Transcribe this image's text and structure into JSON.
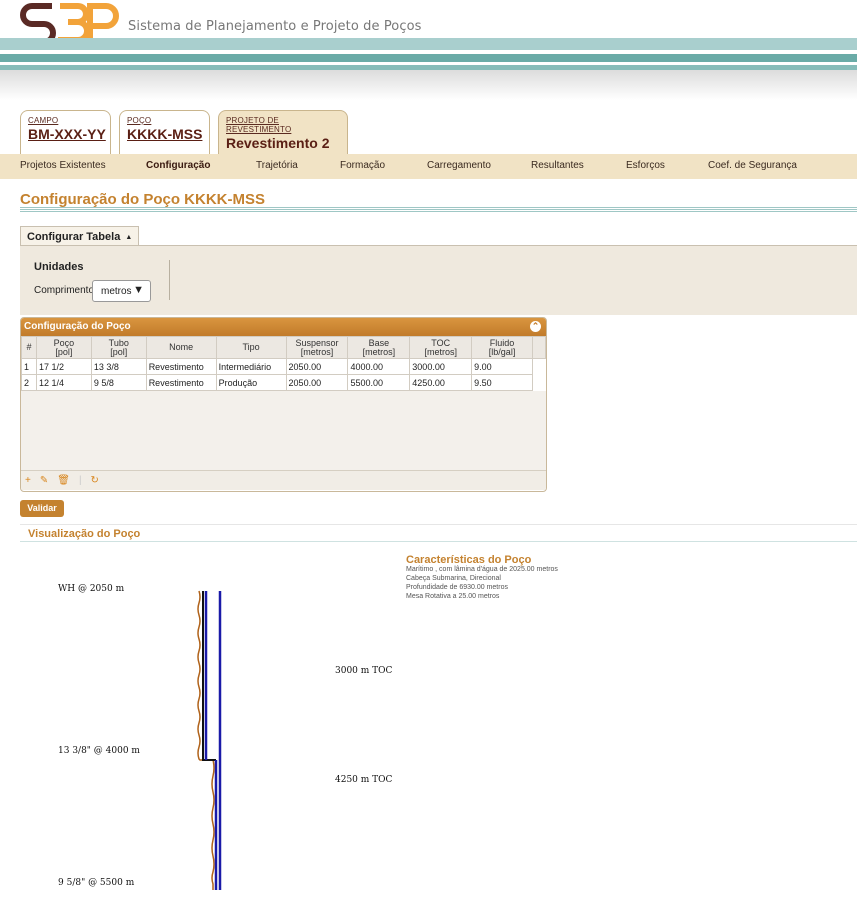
{
  "header": {
    "app_title": "Sistema de Planejamento e Projeto de Poços",
    "logo_text": "S3P"
  },
  "context_tabs": [
    {
      "label": "CAMPO",
      "value": "BM-XXX-YY"
    },
    {
      "label": "POÇO",
      "value": "KKKK-MSS"
    },
    {
      "label": "PROJETO DE REVESTIMENTO",
      "value": "Revestimento 2"
    }
  ],
  "nav": {
    "items": [
      "Projetos Existentes",
      "Configuração",
      "Trajetória",
      "Formação",
      "Carregamento",
      "Resultantes",
      "Esforços",
      "Coef. de Segurança"
    ],
    "active": "Configuração"
  },
  "page_title": "Configuração do Poço KKKK-MSS",
  "config_panel": {
    "tab_label": "Configurar Tabela",
    "units_title": "Unidades",
    "length_label": "Comprimento",
    "length_value": "metros"
  },
  "grid": {
    "title": "Configuração do Poço",
    "columns": [
      "#",
      "Poço\n[pol]",
      "Tubo\n[pol]",
      "Nome",
      "Tipo",
      "Suspensor\n[metros]",
      "Base\n[metros]",
      "TOC\n[metros]",
      "Fluido\n[lb/gal]"
    ],
    "rows": [
      [
        "1",
        "17 1/2",
        "13 3/8",
        "Revestimento",
        "Intermediário",
        "2050.00",
        "4000.00",
        "3000.00",
        "9.00"
      ],
      [
        "2",
        "12 1/4",
        "9 5/8",
        "Revestimento",
        "Produção",
        "2050.00",
        "5500.00",
        "4250.00",
        "9.50"
      ]
    ]
  },
  "validate_label": "Validar",
  "visualization": {
    "title": "Visualização do Poço",
    "labels": {
      "wh": "WH @ 2050 m",
      "toc1": "3000 m TOC",
      "shoe1": "13 3/8\" @ 4000 m",
      "toc2": "4250 m TOC",
      "shoe2": "9 5/8\" @ 5500 m"
    },
    "characteristics": {
      "title": "Características do Poço",
      "lines": [
        "Marítimo , com lâmina d'água de 2025.00 metros",
        "Cabeça Submarina, Direcional",
        "Profundidade de 6930.00 metros",
        "Mesa Rotativa a 25.00 metros"
      ]
    }
  },
  "colors": {
    "accent": "#c4822f",
    "nav_bg": "#f1e3c5",
    "teal": "#6aaba7",
    "casing_blue": "#1a1aa8",
    "cement": "#b0621a"
  }
}
